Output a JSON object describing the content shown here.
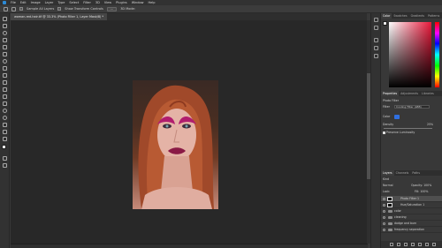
{
  "menu": {
    "items": [
      "File",
      "Edit",
      "Image",
      "Layer",
      "Type",
      "Select",
      "Filter",
      "3D",
      "View",
      "Plugins",
      "Window",
      "Help"
    ]
  },
  "options": {
    "sample": "Sample All Layers",
    "show_transform": "Show Transform Controls",
    "align_label": "3D Mode:"
  },
  "document": {
    "tab_title": "woman-red-hair.tif @ 33.3% (Photo Filter 1, Layer Mask/8) *"
  },
  "color_panel": {
    "tabs": [
      "Color",
      "Swatches",
      "Gradients",
      "Patterns"
    ]
  },
  "properties": {
    "tabs": [
      "Properties",
      "Adjustments",
      "Libraries"
    ],
    "title": "Photo Filter",
    "filter_label": "Filter",
    "filter_value": "Cooling Filter (LBB)",
    "color_label": "Color",
    "density_label": "Density",
    "density_value": "25%",
    "preserve_label": "Preserve Luminosity"
  },
  "layers": {
    "tabs": [
      "Layers",
      "Channels",
      "Paths"
    ],
    "kind_label": "Kind",
    "blend_mode": "Normal",
    "opacity_label": "Opacity: 100%",
    "lock_label": "Lock:",
    "fill_label": "Fill: 100%",
    "rows": [
      {
        "name": "Photo Filter 1",
        "type": "adjust",
        "selected": true
      },
      {
        "name": "Hue/Saturation 1",
        "type": "adjust",
        "selected": false
      },
      {
        "name": "color",
        "type": "folder",
        "selected": false
      },
      {
        "name": "cleaning",
        "type": "folder",
        "selected": false
      },
      {
        "name": "dodge and burn",
        "type": "folder",
        "selected": false
      },
      {
        "name": "frequency separation",
        "type": "folder",
        "selected": false
      }
    ]
  },
  "colors": {
    "accent_blue": "#2f6fe0",
    "picker_hue": "#e8183a"
  }
}
